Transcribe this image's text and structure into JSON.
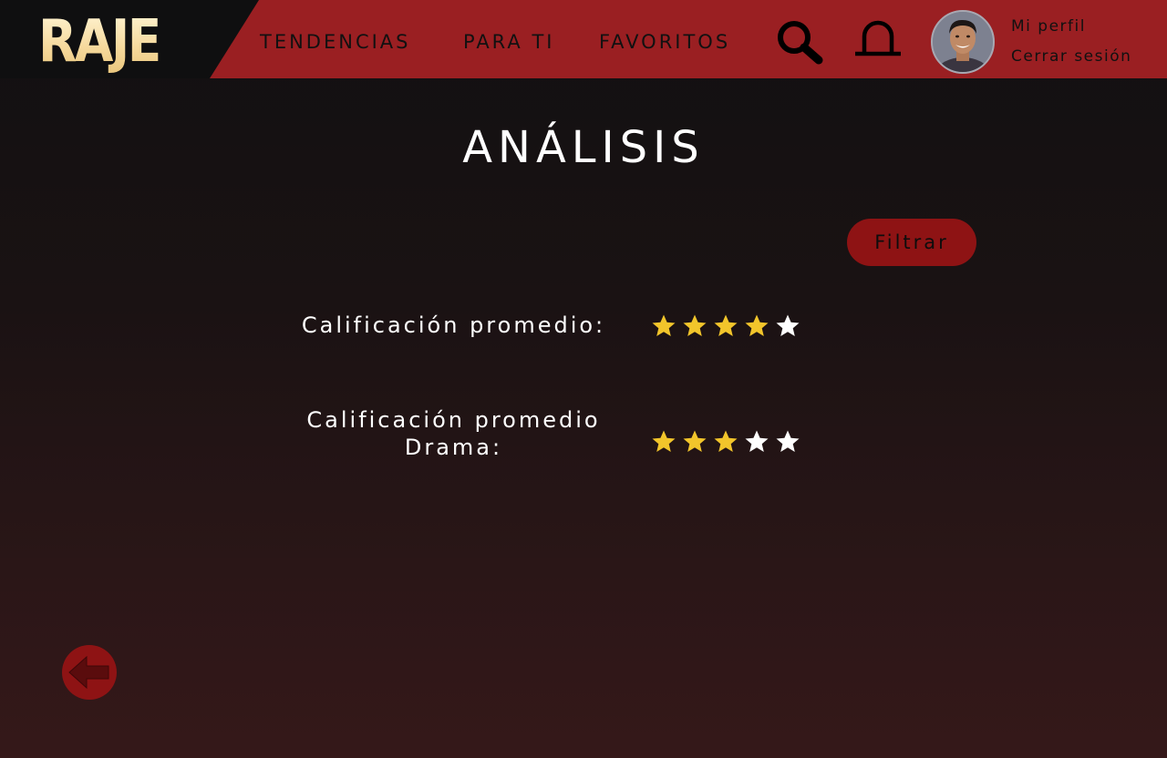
{
  "header": {
    "logo_text": "RAJE",
    "nav": {
      "trending": "TENDENCIAS",
      "for_you": "PARA TI",
      "favorites": "FAVORITOS"
    },
    "icons": {
      "search": "search-icon",
      "notifications": "bell-icon",
      "avatar": "user-avatar"
    },
    "profile_link": "Mi perfil",
    "logout_link": "Cerrar sesión"
  },
  "main": {
    "title": "ANÁLISIS",
    "filter_label": "Filtrar",
    "ratings": [
      {
        "label": "Calificación promedio:",
        "value": 4,
        "max": 5
      },
      {
        "label": "Calificación promedio Drama:",
        "value": 3,
        "max": 5
      }
    ]
  },
  "footer": {
    "back_icon": "arrow-left-icon"
  },
  "colors": {
    "brand_red": "#9a1f22",
    "button_red": "#8e1314",
    "star_filled": "#f2c52b",
    "star_empty": "#ffffff",
    "logo_gold": "#f6dfa3"
  }
}
